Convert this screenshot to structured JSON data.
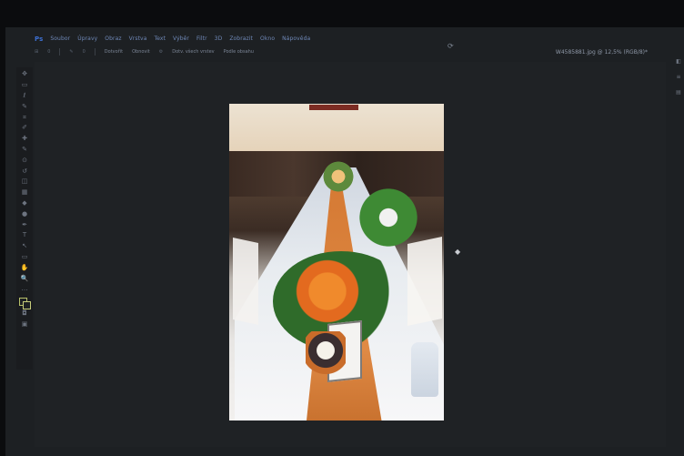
{
  "menubar": {
    "logo": "Ps",
    "items": [
      "Soubor",
      "Úpravy",
      "Obraz",
      "Vrstva",
      "Text",
      "Výběr",
      "Filtr",
      "3D",
      "Zobrazit",
      "Okno",
      "Nápověda"
    ]
  },
  "options_bar": {
    "tool_value_1": "0",
    "tool_value_2": "0",
    "button_1": "Dotvořit",
    "button_2": "Obnovit",
    "button_3": "Dotv. všech vrstev",
    "button_4": "Podle obsahu",
    "settings_icon": "gear-icon"
  },
  "document_tab": {
    "title": "W4585881.jpg @ 12,5% (RGB/8)*"
  },
  "toolbar": {
    "tools": [
      "move-icon",
      "marquee-icon",
      "lasso-icon",
      "quick-select-icon",
      "crop-icon",
      "eyedropper-icon",
      "spot-heal-icon",
      "brush-icon",
      "clone-stamp-icon",
      "history-brush-icon",
      "eraser-icon",
      "gradient-icon",
      "blur-icon",
      "dodge-icon",
      "pen-icon",
      "type-icon",
      "path-select-icon",
      "shape-icon",
      "hand-icon",
      "zoom-icon",
      "more-icon"
    ],
    "glyphs": [
      "✥",
      "▭",
      "ℓ",
      "✎",
      "⌗",
      "✐",
      "✚",
      "✎",
      "⊙",
      "↺",
      "◫",
      "▦",
      "◆",
      "●",
      "✒",
      "T",
      "↖",
      "▭",
      "✋",
      "🔍",
      "…"
    ],
    "colors": {
      "foreground": "#b7c06a",
      "background": "#c6cc7a"
    }
  },
  "canvas": {
    "image_alt": "Wedding banquet table with flower arrangements"
  },
  "colors": {
    "ui_background": "#1d2023",
    "menu_text": "#6f88b7",
    "accent": "#3c6fd1"
  }
}
